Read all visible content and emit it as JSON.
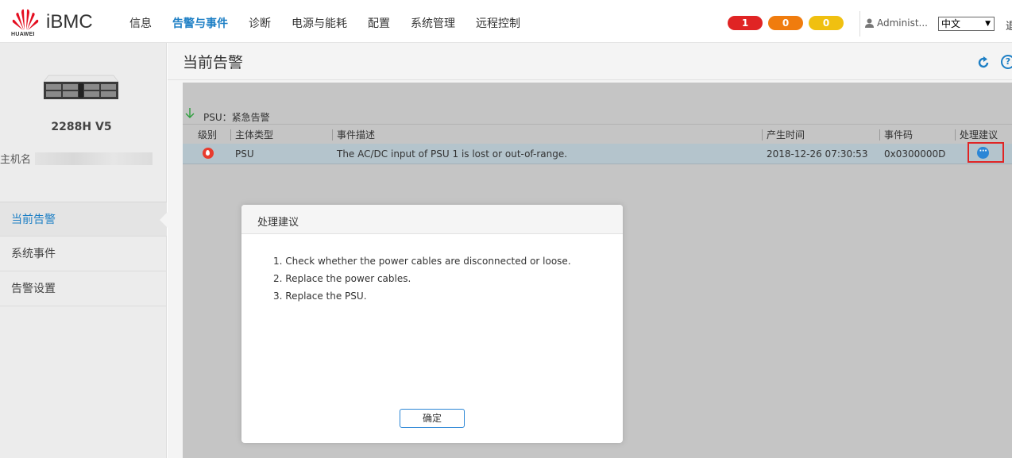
{
  "header": {
    "brand_small": "HUAWEI",
    "brand": "iBMC",
    "nav": [
      "信息",
      "告警与事件",
      "诊断",
      "电源与能耗",
      "配置",
      "系统管理",
      "远程控制"
    ],
    "active_nav": 1,
    "badges": {
      "critical": "1",
      "major": "0",
      "minor": "0"
    },
    "user": "Administ...",
    "language": "中文",
    "logout": "退"
  },
  "sidebar": {
    "model": "2288H V5",
    "hostname_label": "主机名",
    "items": [
      "当前告警",
      "系统事件",
      "告警设置"
    ]
  },
  "main": {
    "title": "当前告警",
    "help": "?",
    "group_label": "PSU：紧急告警",
    "columns": [
      "级别",
      "主体类型",
      "事件描述",
      "产生时间",
      "事件码",
      "处理建议"
    ],
    "row": {
      "type": "PSU",
      "description": "The AC/DC input of PSU 1 is lost or out-of-range.",
      "time": "2018-12-26 07:30:53",
      "code": "0x0300000D",
      "suggest": "···"
    }
  },
  "dialog": {
    "title": "处理建议",
    "lines": [
      "1. Check whether the power cables are disconnected or loose.",
      "2. Replace the power cables.",
      "3. Replace the PSU."
    ],
    "ok_label": "确定"
  },
  "colors": {
    "accent": "#1d7fc5",
    "critical": "#e02424",
    "major": "#f07c0e",
    "minor": "#f0c010"
  }
}
